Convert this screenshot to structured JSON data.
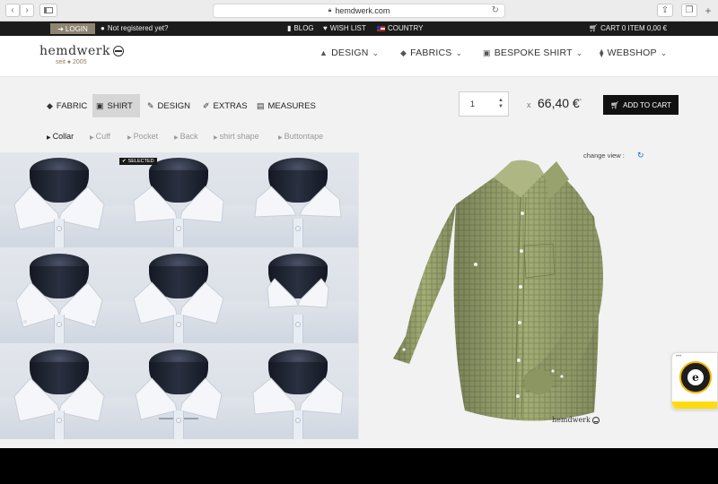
{
  "browser": {
    "url": "hemdwerk.com",
    "back_icon": "chevron-left",
    "forward_icon": "chevron-right",
    "sidebar_icon": "sidebar",
    "lock_icon": "lock",
    "reload_icon": "reload",
    "share_icon": "share",
    "tabs_icon": "tabs",
    "newtab_icon": "plus"
  },
  "topbar": {
    "login": "LOGIN",
    "not_registered": "Not registered yet?",
    "blog": "BLOG",
    "wishlist": "WISH LIST",
    "country": "COUNTRY",
    "cart": "CART 0 ITEM 0,00 €"
  },
  "header": {
    "logo": "hemdwerk",
    "logo_sub": "seit ● 2005",
    "nav": [
      {
        "label": "DESIGN",
        "icon": "hat-icon"
      },
      {
        "label": "FABRICS",
        "icon": "fabric-icon"
      },
      {
        "label": "BESPOKE SHIRT",
        "icon": "shirt-icon"
      },
      {
        "label": "WEBSHOP",
        "icon": "tie-icon"
      }
    ]
  },
  "configurator": {
    "steps": [
      {
        "label": "FABRIC",
        "icon": "fabric-icon",
        "active": false
      },
      {
        "label": "SHIRT",
        "icon": "shirt-icon",
        "active": true
      },
      {
        "label": "DESIGN",
        "icon": "design-icon",
        "active": false
      },
      {
        "label": "EXTRAS",
        "icon": "pin-icon",
        "active": false
      },
      {
        "label": "MEASURES",
        "icon": "measure-icon",
        "active": false
      }
    ],
    "quantity": "1",
    "times": "x",
    "price": "66,40 €",
    "price_mark": "*",
    "add_to_cart": "ADD TO CART",
    "sub_options": [
      {
        "label": "Collar",
        "active": true
      },
      {
        "label": "Cuff",
        "active": false
      },
      {
        "label": "Pocket",
        "active": false
      },
      {
        "label": "Back",
        "active": false
      },
      {
        "label": "shirt shape",
        "active": false
      },
      {
        "label": "Buttontape",
        "active": false
      }
    ],
    "selected_badge": "SELECTED",
    "change_view": "change view :",
    "preview_brand": "hemdwerk"
  },
  "colors": {
    "topbar": "#1b1b1b",
    "login_bg": "#8e8472",
    "shirt_fabric": "#9aa76b",
    "active_tab": "#d6d6d6",
    "trusted_yellow": "#ffdc0f"
  }
}
